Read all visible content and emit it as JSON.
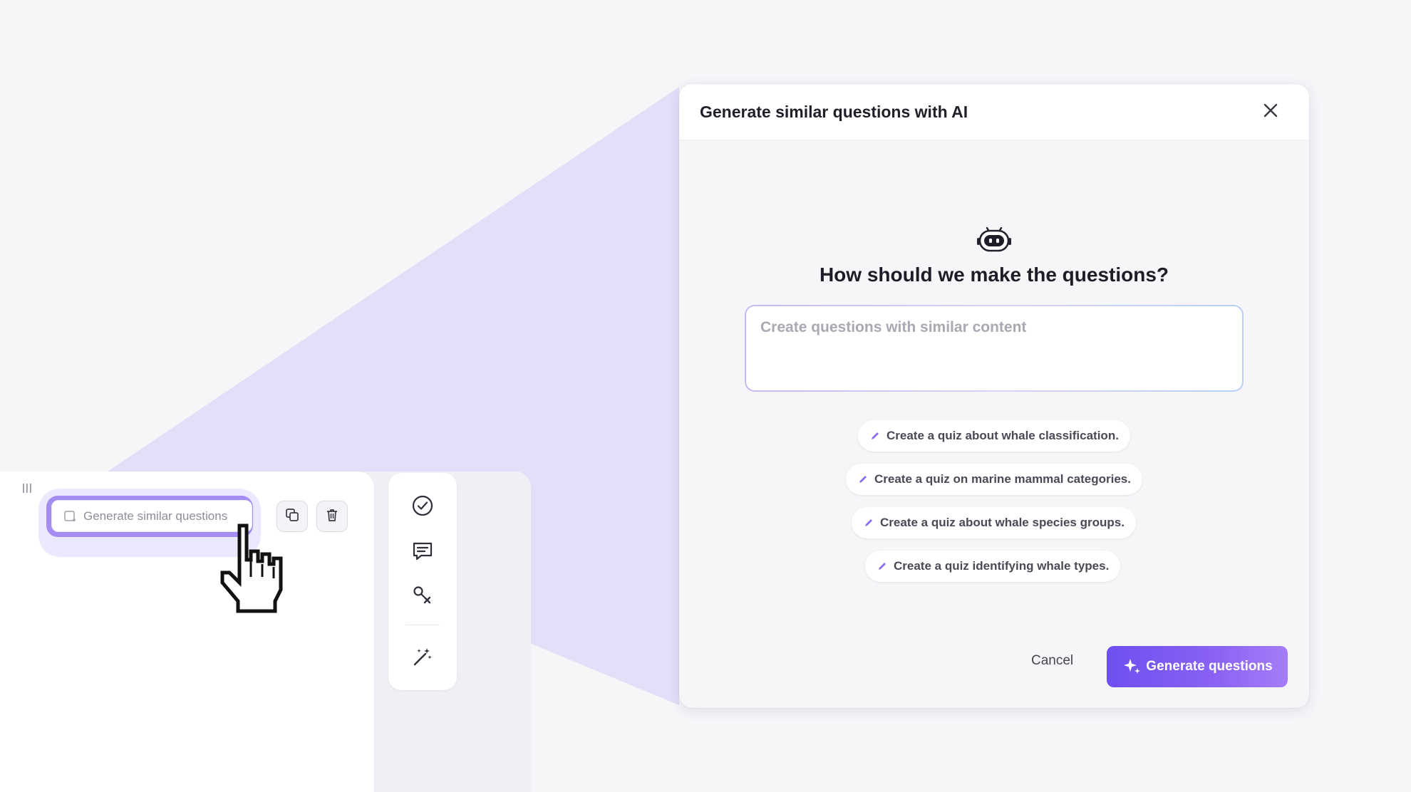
{
  "editor": {
    "generate_similar_label": "Generate similar questions",
    "copy_icon": "copy-icon",
    "delete_icon": "trash-icon",
    "rail_icons": [
      "check-circle-icon",
      "comment-icon",
      "key-icon",
      "magic-wand-icon"
    ]
  },
  "dialog": {
    "title": "Generate similar questions with AI",
    "heading": "How should we make the questions?",
    "prompt_placeholder": "Create questions with similar content",
    "prompt_value": "",
    "suggestions": [
      "Create a quiz about whale classification.",
      "Create a quiz on marine mammal categories.",
      "Create a quiz about whale species groups.",
      "Create a quiz identifying whale types."
    ],
    "cancel_label": "Cancel",
    "generate_label": "Generate questions"
  },
  "colors": {
    "accent": "#7a58f2",
    "accent_end": "#a47ef8",
    "zoom_wedge": "#ddd7f7",
    "background": "#f6f6f9"
  }
}
